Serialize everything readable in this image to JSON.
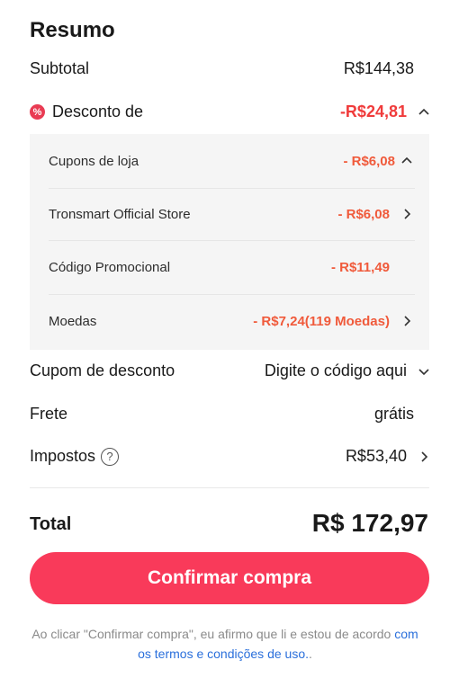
{
  "summary": {
    "title": "Resumo",
    "subtotal_label": "Subtotal",
    "subtotal_value": "R$144,38",
    "discount_label": "Desconto de",
    "discount_value": "-R$24,81",
    "discount_badge": "%"
  },
  "discount_breakdown": {
    "store_coupons_label": "Cupons de loja",
    "store_coupons_value": "- R$6,08",
    "store_label": "Tronsmart Official Store",
    "store_value": "- R$6,08",
    "promo_code_label": "Código Promocional",
    "promo_code_value": "- R$11,49",
    "coins_label": "Moedas",
    "coins_value": "- R$7,24(119 Moedas)"
  },
  "details": {
    "coupon_label": "Cupom de desconto",
    "coupon_placeholder": "Digite o código aqui",
    "shipping_label": "Frete",
    "shipping_value": "grátis",
    "taxes_label": "Impostos",
    "taxes_value": "R$53,40"
  },
  "total": {
    "label": "Total",
    "value": "R$ 172,97"
  },
  "confirm_button": "Confirmar compra",
  "legal": {
    "text": "Ao clicar \"Confirmar compra\", eu afirmo que li e estou de acordo ",
    "link": "com os termos e condições de uso.",
    "suffix": "."
  },
  "colors": {
    "accent": "#f93a5a",
    "discount_red": "#f03b3b",
    "panel_bg": "#f5f5f5",
    "link": "#2a6fdb"
  }
}
